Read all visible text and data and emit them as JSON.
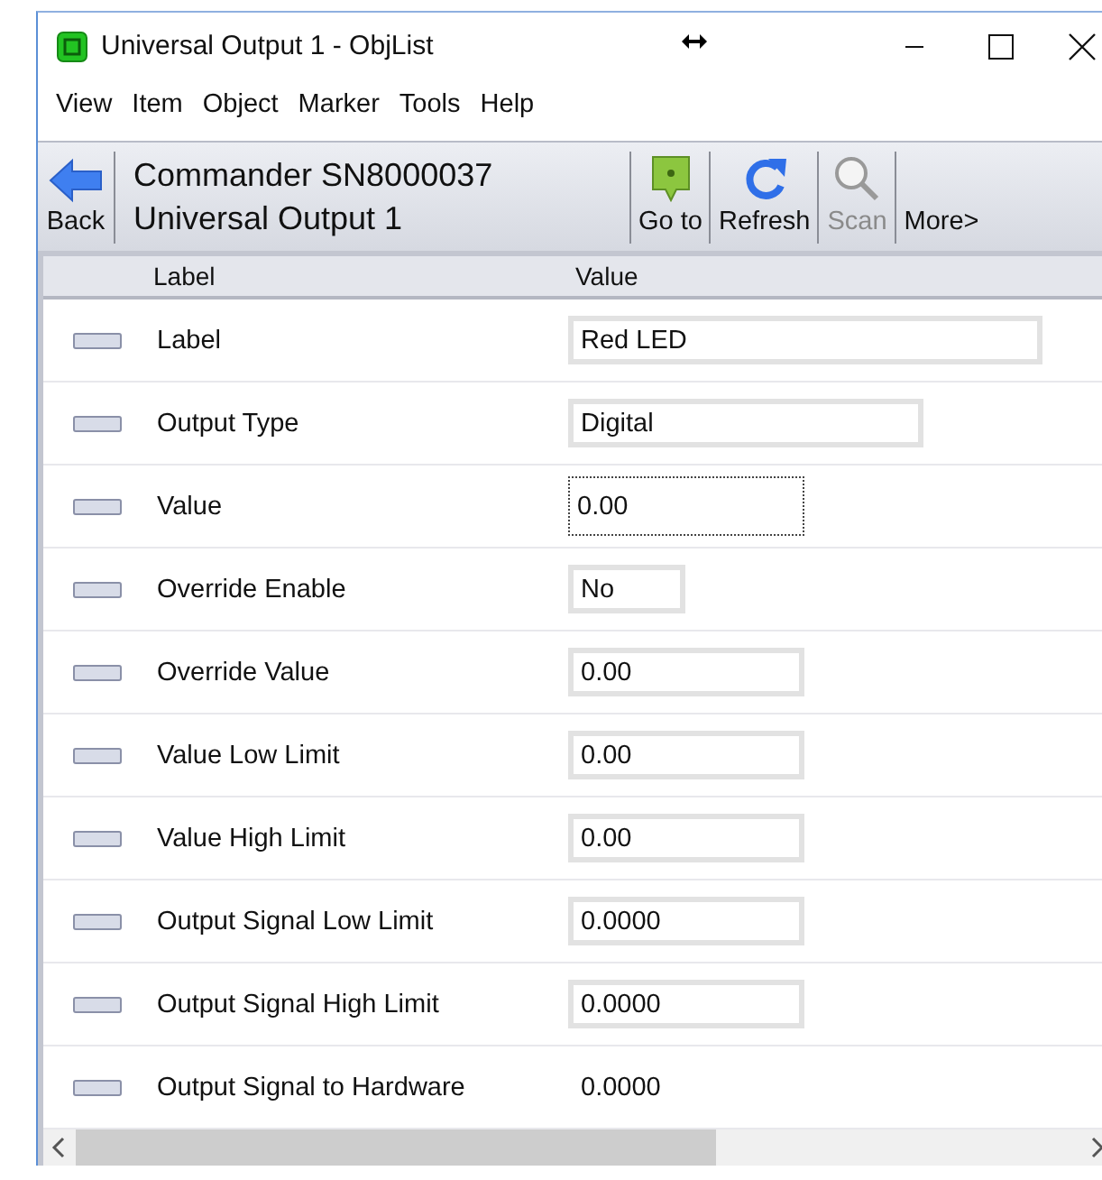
{
  "window": {
    "title": "Universal Output 1 - ObjList"
  },
  "menu": [
    "View",
    "Item",
    "Object",
    "Marker",
    "Tools",
    "Help"
  ],
  "toolbar": {
    "back": {
      "label": "Back"
    },
    "heading": [
      "Commander SN8000037",
      "Universal Output 1"
    ],
    "buttons": [
      {
        "kind": "goto",
        "label": "Go to",
        "disabled": false
      },
      {
        "kind": "refresh",
        "label": "Refresh",
        "disabled": false
      },
      {
        "kind": "scan",
        "label": "Scan",
        "disabled": true
      },
      {
        "kind": "more",
        "label": "More>",
        "disabled": false
      }
    ]
  },
  "table": {
    "columns": [
      "Label",
      "Value"
    ],
    "rows": [
      {
        "label": "Label",
        "value": "Red LED",
        "kind": "field",
        "focused": false
      },
      {
        "label": "Output Type",
        "value": "Digital",
        "kind": "field",
        "focused": false
      },
      {
        "label": "Value",
        "value": "0.00",
        "kind": "field",
        "focused": true
      },
      {
        "label": "Override Enable",
        "value": "No",
        "kind": "field",
        "focused": false
      },
      {
        "label": "Override Value",
        "value": "0.00",
        "kind": "field",
        "focused": false
      },
      {
        "label": "Value Low Limit",
        "value": "0.00",
        "kind": "field",
        "focused": false
      },
      {
        "label": "Value High Limit",
        "value": "0.00",
        "kind": "field",
        "focused": false
      },
      {
        "label": "Output Signal Low Limit",
        "value": "0.0000",
        "kind": "field",
        "focused": false
      },
      {
        "label": "Output Signal High Limit",
        "value": "0.0000",
        "kind": "field",
        "focused": false
      },
      {
        "label": "Output Signal to Hardware",
        "value": "0.0000",
        "kind": "text"
      }
    ]
  }
}
